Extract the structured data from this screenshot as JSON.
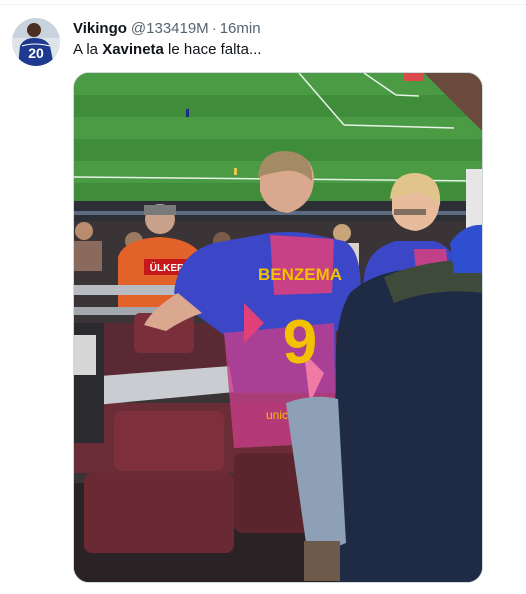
{
  "tweet": {
    "display_name": "Vikingo",
    "handle": "@133419M",
    "separator": "·",
    "time": "16min",
    "text_before": "A la ",
    "text_bold": "Xavineta",
    "text_after": " le hace falta..."
  },
  "avatar": {
    "jersey_number": "20"
  },
  "media": {
    "jersey_name": "BENZEMA",
    "jersey_number": "9",
    "jersey_sponsor": "unicef",
    "sponsor_banner": "ÜLKER"
  },
  "colors": {
    "name_text": "#0f1419",
    "secondary_text": "#536471",
    "media_border": "#cfd9de",
    "pitch_green": "#3f8d3a",
    "jersey_blue": "#3b47c7",
    "jersey_pink": "#e2407a",
    "jersey_gold": "#f2c200"
  }
}
